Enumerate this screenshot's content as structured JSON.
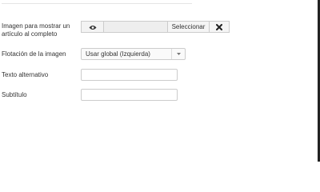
{
  "fields": {
    "image": {
      "label": "Imagen para mostrar un artículo al completo",
      "path_value": "",
      "select_label": "Seleccionar",
      "preview_icon": "eye-icon",
      "clear_icon": "close-x-icon"
    },
    "float": {
      "label": "Flotación de la imagen",
      "selected": "Usar global (Izquierda)",
      "arrow_icon": "caret-down-icon"
    },
    "alt_text": {
      "label": "Texto alternativo",
      "value": ""
    },
    "caption": {
      "label": "Subtítulo",
      "value": ""
    }
  }
}
